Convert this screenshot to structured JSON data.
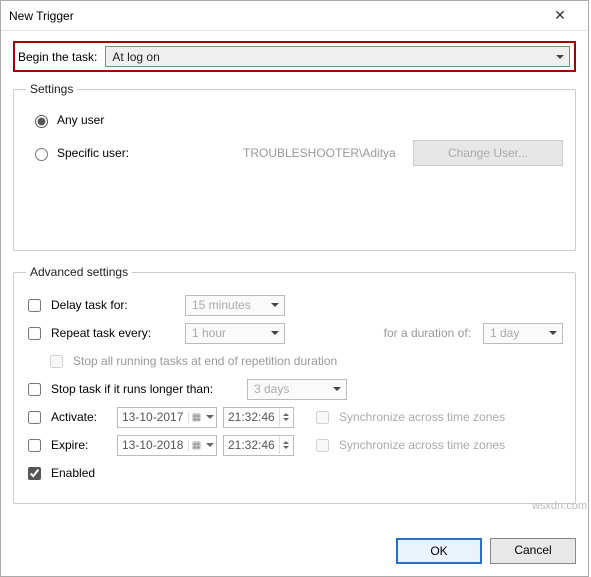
{
  "window": {
    "title": "New Trigger"
  },
  "begin": {
    "label": "Begin the task:",
    "selected": "At log on"
  },
  "settings": {
    "legend": "Settings",
    "any_user": "Any user",
    "specific_user": "Specific user:",
    "domain_user": "TROUBLESHOOTER\\Aditya",
    "change_user": "Change User..."
  },
  "advanced": {
    "legend": "Advanced settings",
    "delay": {
      "label": "Delay task for:",
      "value": "15 minutes",
      "checked": false
    },
    "repeat": {
      "label": "Repeat task every:",
      "value": "1 hour",
      "checked": false,
      "duration_label": "for a duration of:",
      "duration_value": "1 day"
    },
    "stop_at_end": {
      "label": "Stop all running tasks at end of repetition duration",
      "checked": false
    },
    "stop_longer": {
      "label": "Stop task if it runs longer than:",
      "value": "3 days",
      "checked": false
    },
    "activate": {
      "label": "Activate:",
      "date": "13-10-2017",
      "time": "21:32:46",
      "checked": false,
      "sync": "Synchronize across time zones"
    },
    "expire": {
      "label": "Expire:",
      "date": "13-10-2018",
      "time": "21:32:46",
      "checked": false,
      "sync": "Synchronize across time zones"
    },
    "enabled": {
      "label": "Enabled",
      "checked": true
    }
  },
  "buttons": {
    "ok": "OK",
    "cancel": "Cancel"
  },
  "watermark": "wsxdn.com"
}
